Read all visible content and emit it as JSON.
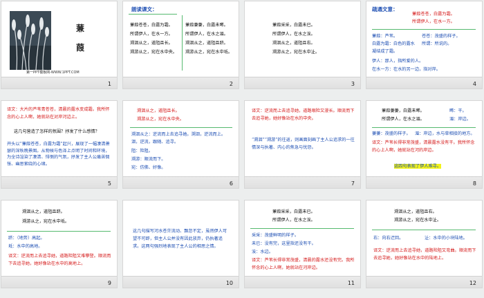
{
  "slides": [
    {
      "num": "1",
      "title_a": "蒹",
      "title_b": "葭",
      "footer": "第一PPT模板网-WWW.1PPT.COM"
    },
    {
      "num": "2",
      "heading": "朗读课文：",
      "col1": [
        "蒹葭苍苍，白露为霜。",
        "所谓伊人，在水一方。",
        "溯洄从之，道阻且长。",
        "溯游从之，宛在水中央。"
      ],
      "col2": [
        "蒹葭萋萋，白露未晞。",
        "所谓伊人，在水之湄。",
        "溯洄从之，道阻且跻。",
        "溯游从之，宛在水中坻。"
      ]
    },
    {
      "num": "3",
      "lines": [
        "蒹葭采采，白露未已。",
        "所谓伊人，在水之涘。",
        "溯洄从之，道阻且右。",
        "溯游从之，宛在水中沚。"
      ]
    },
    {
      "num": "4",
      "heading": "疏通文意：",
      "poem": [
        "蒹葭苍苍，白露为霜。",
        "所谓伊人，在水一方。"
      ],
      "notes": [
        "蒹葭：芦苇。",
        "苍苍：茂盛的样子。",
        "白露为霜：白色的露水凝结成了霜。",
        "所谓：所说的。",
        "伊人：那人，指所爱的人。",
        "在水一方：在水的另一边，指对岸。"
      ]
    },
    {
      "num": "5",
      "para1": "译文：大片的芦苇青苍苍，清晨的露水变成霜。我所怀念的心上人啊，她就站在对岸河边上。",
      "question": "这几句营造了怎样的氛围？抒发了什么感情？",
      "para2": "开头以“蒹葭苍苍，白露为霜”起兴，展现了一幅凄清萧瑟的深秋晚景图。从物候与色泽上点明了时间和环境，为全诗渲染了凄清、悱恻的气氛，抒发了主人公痛苦惆怅、幽思萦绕的心绪。"
    },
    {
      "num": "6",
      "poem": [
        "溯洄从之，道阻且长。",
        "溯游从之，宛在水中央。"
      ],
      "notes": [
        "溯洄从之：逆流而上去追寻她。溯洄，逆流而上。洄，逆流，跟随、追寻。",
        "阻：险阻。",
        "溯游：顺流而下。",
        "宛：仿佛、好像。"
      ]
    },
    {
      "num": "7",
      "para1": "译文：逆流而上去追寻她，道路艰险又漫长。顺流而下去追寻她，她好像站在水的中央。",
      "para2": "“溯洄”“溯游”的往返，则画面刻画了主人公追求的一往情深与执著、内心的焦急与忧怨。"
    },
    {
      "num": "8",
      "poem": [
        "蒹葭萋萋，白露未晞。",
        "所谓伊人，在水之湄。"
      ],
      "side1": "晞：干。",
      "side2": "湄：岸边。",
      "notes": [
        "萋萋：茂盛的样子。",
        "湄：岸边，水与草相接的地方。"
      ],
      "para": "译文：芦苇长得非常茂盛，清晨露水没有干。我所怀念的心上人啊，她就站在河的岸边。",
      "q": "这四句表现了伊人难寻。"
    },
    {
      "num": "9",
      "poem": [
        "溯洄从之，道阻且跻。",
        "溯游从之，宛在水中坻。"
      ],
      "notes": [
        "跻：（地势）高起。",
        "坻：水中的高地。"
      ],
      "para": "译文：逆流而上去追寻她，道路险阻又难攀登。顺流而下去追寻她，她好像站在水中的高地上。"
    },
    {
      "num": "10",
      "para": "这几句描写河水苍茫流动、飘忽不定，虽然伊人可望不可即，但主人公并没有因此放弃，仍执著追求。这两句强烈地表现了主人公的相思之情。"
    },
    {
      "num": "11",
      "poem": [
        "蒹葭采采，白露未已。",
        "所谓伊人，在水之涘。"
      ],
      "notes": [
        "采采：茂盛鲜明的样子。",
        "未已：没有完，这里指还没有干。",
        "涘：水边。"
      ],
      "para": "译文：芦苇长得非常茂盛，清晨的露水还没有完。我所怀念的心上人啊，她就站在河岸边。"
    },
    {
      "num": "12",
      "poem": [
        "溯洄从之，道阻且右。",
        "溯游从之，宛在水中沚。"
      ],
      "notes": [
        "右：向右迂回。",
        "沚：水中的小块陆地。"
      ],
      "para": "译文：逆流而上去追寻她，道路险阻又弯曲。顺流而下去追寻她，她好像站在水中的陆地上。"
    }
  ]
}
